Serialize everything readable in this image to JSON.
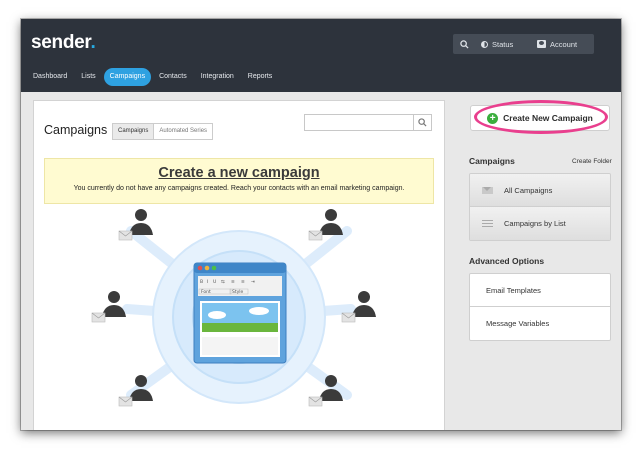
{
  "app": {
    "logo": "sender",
    "logo_dot": "."
  },
  "top_actions": {
    "status_label": "Status",
    "account_label": "Account"
  },
  "nav": {
    "items": [
      {
        "label": "Dashboard",
        "active": false
      },
      {
        "label": "Lists",
        "active": false
      },
      {
        "label": "Campaigns",
        "active": true
      },
      {
        "label": "Contacts",
        "active": false
      },
      {
        "label": "Integration",
        "active": false
      },
      {
        "label": "Reports",
        "active": false
      }
    ]
  },
  "main": {
    "title": "Campaigns",
    "tabs": [
      {
        "label": "Campaigns",
        "active": true
      },
      {
        "label": "Automated Series",
        "active": false
      }
    ],
    "search": {
      "value": "",
      "placeholder": ""
    },
    "banner": {
      "title": "Create a new campaign",
      "subtitle": "You currently do not have any campaigns created. Reach your contacts with an email marketing campaign."
    },
    "editor": {
      "font_select": "Font",
      "style_select": "Style"
    }
  },
  "sidebar": {
    "create_button": "Create New Campaign",
    "campaigns_heading": "Campaigns",
    "create_folder": "Create Folder",
    "campaign_items": [
      {
        "label": "All Campaigns",
        "icon": "envelope-icon"
      },
      {
        "label": "Campaigns by List",
        "icon": "list-icon"
      }
    ],
    "advanced_heading": "Advanced Options",
    "advanced_items": [
      {
        "label": "Email Templates"
      },
      {
        "label": "Message Variables"
      }
    ]
  },
  "colors": {
    "header_bg": "#2d333c",
    "nav_active": "#2ea1e1",
    "logo_dot": "#27aae1",
    "highlight_ring": "#e93f8e",
    "create_icon": "#3aae3d",
    "banner_bg": "#fffbd1"
  }
}
